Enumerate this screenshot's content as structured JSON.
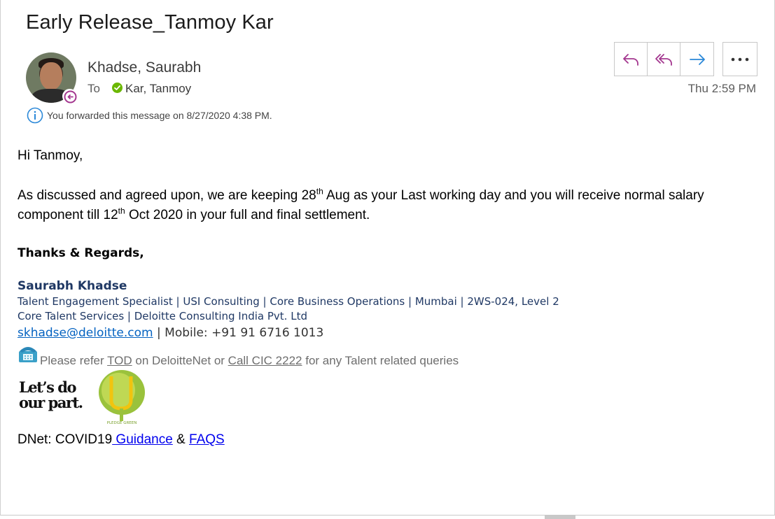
{
  "subject": "Early Release_Tanmoy Kar",
  "sender": "Khadse, Saurabh",
  "to_label": "To",
  "recipient": "Kar, Tanmoy",
  "time": "Thu 2:59 PM",
  "info_message": "You forwarded this message on 8/27/2020 4:38 PM.",
  "toolbar": {
    "reply_icon": "reply-icon",
    "reply_all_icon": "reply-all-icon",
    "forward_icon": "forward-icon",
    "more_icon": "more-options-icon"
  },
  "body": {
    "greeting": "Hi Tanmoy,",
    "p1_part1": "As discussed and agreed upon, we are keeping 28",
    "p1_sup1": "th",
    "p1_part2": " Aug as your Last working day and you will receive normal salary",
    "p2_part1": "component till 12",
    "p2_sup1": "th",
    "p2_part2": " Oct 2020 in your full and final settlement.",
    "regards": "Thanks & Regards,"
  },
  "signature": {
    "name": "Saurabh Khadse",
    "line1": "Talent Engagement Specialist | USI Consulting | Core Business Operations | Mumbai | 2WS-024, Level 2",
    "line2": "Core Talent Services | Deloitte Consulting India Pvt. Ltd",
    "email": "skhadse@deloitte.com",
    "separator": " | ",
    "mobile_label": "Mobile: ",
    "mobile_number": "+91 91 6716 1013",
    "refer_prefix": "Please refer ",
    "refer_tod": "TOD",
    "refer_mid": " on DeloitteNet or  ",
    "refer_cic": "Call CIC 2222",
    "refer_suffix": " for any Talent related queries",
    "logo_line1": "Let’s do",
    "logo_line2": "our part.",
    "green_logo_text": "PLEDGE GREEN"
  },
  "dnet": {
    "prefix": "DNet: COVID19",
    "guidance": " Guidance",
    "amp": " & ",
    "faqs": "FAQS"
  },
  "colors": {
    "accent_purple": "#a4378f",
    "accent_blue": "#2b88d8",
    "signature_navy": "#1f3864",
    "link": "#0563c1",
    "presence_green": "#6bb700"
  }
}
